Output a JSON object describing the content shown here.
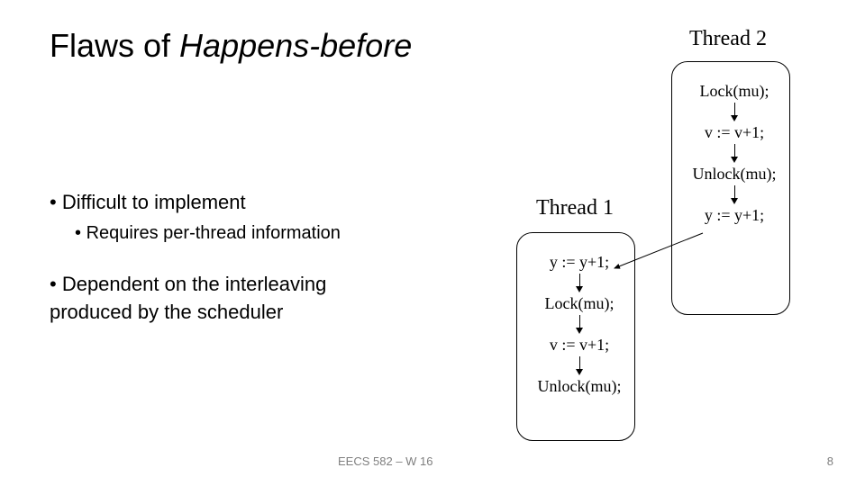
{
  "title_plain": "Flaws of ",
  "title_italic": "Happens-before",
  "bullets": {
    "b1": "Difficult to implement",
    "b1sub": "Requires per-thread information",
    "b2a": "Dependent on the interleaving",
    "b2b": "produced by the scheduler"
  },
  "thread2": {
    "label": "Thread 2",
    "s1": "Lock(mu);",
    "s2": "v := v+1;",
    "s3": "Unlock(mu);",
    "s4": "y := y+1;"
  },
  "thread1": {
    "label": "Thread 1",
    "s1": "y := y+1;",
    "s2": "Lock(mu);",
    "s3": "v := v+1;",
    "s4": "Unlock(mu);"
  },
  "footer": {
    "left": "EECS 582 – W 16",
    "right": "8"
  }
}
